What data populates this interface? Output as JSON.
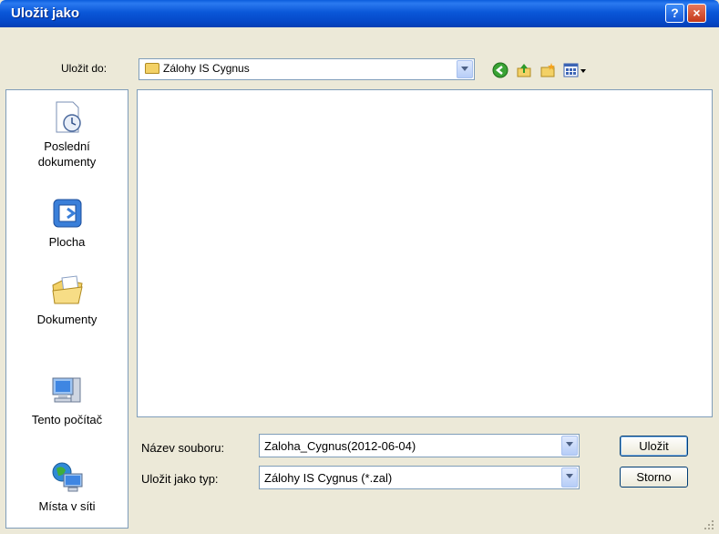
{
  "window": {
    "title": "Uložit jako"
  },
  "toolbar": {
    "save_in_label": "Uložit do:",
    "save_in_value": "Zálohy IS Cygnus",
    "icons": [
      "back-icon",
      "up-folder-icon",
      "new-folder-icon",
      "view-menu-icon"
    ]
  },
  "places": [
    {
      "label_line1": "Poslední",
      "label_line2": "dokumenty",
      "icon": "recent-documents-icon"
    },
    {
      "label_line1": "Plocha",
      "label_line2": "",
      "icon": "desktop-icon"
    },
    {
      "label_line1": "Dokumenty",
      "label_line2": "",
      "icon": "my-documents-icon"
    },
    {
      "label_line1": "Tento počítač",
      "label_line2": "",
      "icon": "my-computer-icon"
    },
    {
      "label_line1": "Místa v síti",
      "label_line2": "",
      "icon": "network-places-icon"
    }
  ],
  "form": {
    "filename_label": "Název souboru:",
    "filename_value": "Zaloha_Cygnus(2012-06-04)",
    "filetype_label": "Uložit jako typ:",
    "filetype_value": "Zálohy IS Cygnus (*.zal)"
  },
  "buttons": {
    "save": "Uložit",
    "cancel": "Storno",
    "help": "?",
    "close": "×"
  },
  "colors": {
    "titlebar": "#0a57d8",
    "dialog_bg": "#ece9d8",
    "close": "#c4391a"
  }
}
